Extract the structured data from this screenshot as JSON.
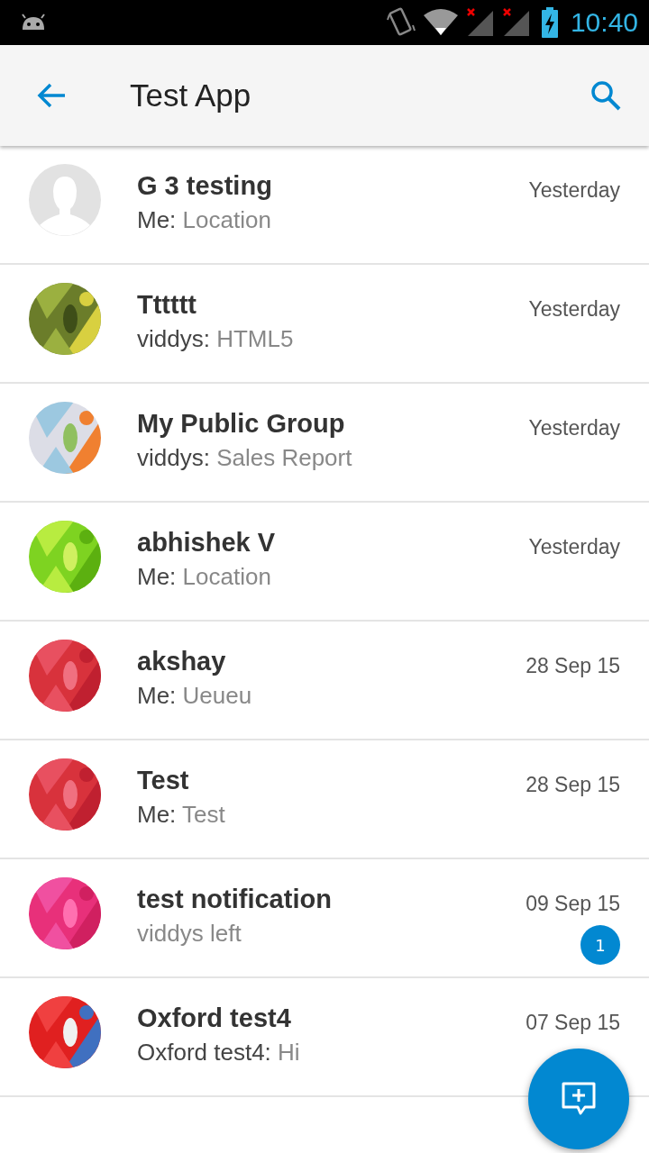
{
  "status_bar": {
    "time": "10:40"
  },
  "app_bar": {
    "title": "Test App"
  },
  "chats": [
    {
      "name": "G 3 testing",
      "sender": "Me:",
      "message": "Location",
      "time": "Yesterday",
      "avatar": {
        "kind": "placeholder"
      }
    },
    {
      "name": "Tttttt",
      "sender": "viddys:",
      "message": "HTML5",
      "time": "Yesterday"
    },
    {
      "name": "My Public Group",
      "sender": "viddys:",
      "message": "Sales Report",
      "time": "Yesterday"
    },
    {
      "name": "abhishek V",
      "sender": "Me:",
      "message": "Location",
      "time": "Yesterday"
    },
    {
      "name": "akshay",
      "sender": "Me:",
      "message": "Ueueu",
      "time": "28 Sep 15"
    },
    {
      "name": "Test",
      "sender": "Me:",
      "message": "Test",
      "time": "28 Sep 15"
    },
    {
      "name": "test notification",
      "message": "viddys left",
      "time": "09 Sep 15",
      "unread": "1"
    },
    {
      "name": "Oxford test4",
      "sender": "Oxford test4:",
      "message": "Hi",
      "time": "07 Sep 15"
    }
  ]
}
